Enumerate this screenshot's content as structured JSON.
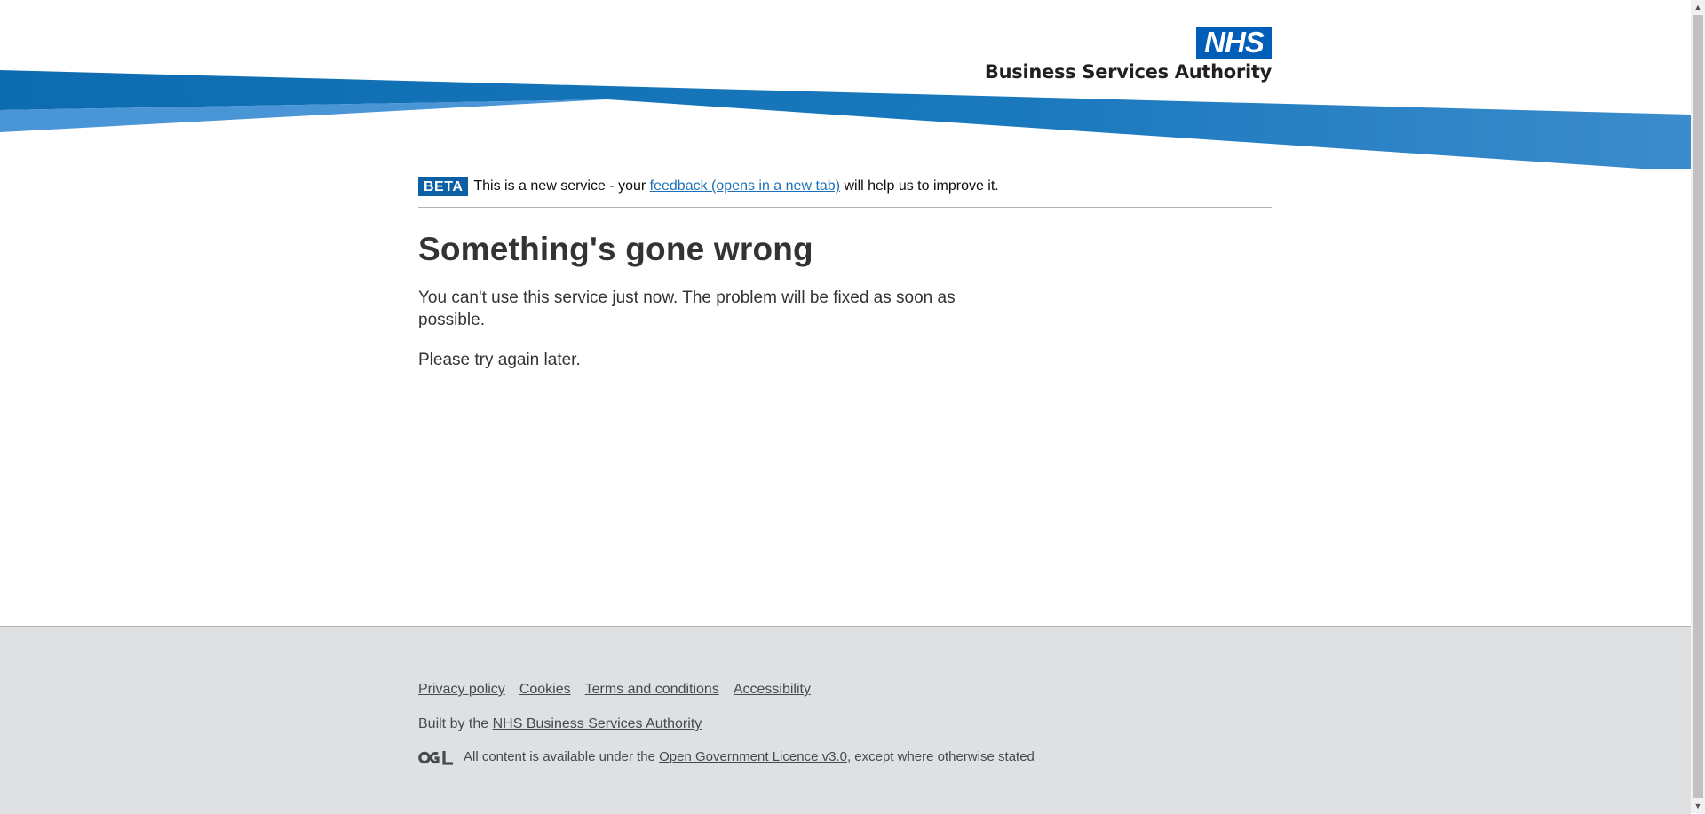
{
  "header": {
    "logo_mark": "NHS",
    "org_name": "Business Services Authority",
    "colors": {
      "primary": "#0072bc",
      "light": "#4a90d0",
      "logo": "#005eb8"
    }
  },
  "phase_banner": {
    "tag": "BETA",
    "text_before": "This is a new service - your ",
    "link": "feedback (opens in a new tab)",
    "text_after": " will help us to improve it."
  },
  "main": {
    "heading": "Something's gone wrong",
    "paragraph_1": "You can't use this service just now. The problem will be fixed as soon as possible.",
    "paragraph_2": "Please try again later."
  },
  "footer": {
    "links": [
      "Privacy policy",
      "Cookies",
      "Terms and conditions",
      "Accessibility"
    ],
    "built_by_text": "Built by the ",
    "built_by_link": "NHS Business Services Authority",
    "ogl_icon": "ogl-logo-icon",
    "licence_before": "All content is available under the ",
    "licence_link": "Open Government Licence v3.0",
    "licence_after": ", except where otherwise stated"
  }
}
